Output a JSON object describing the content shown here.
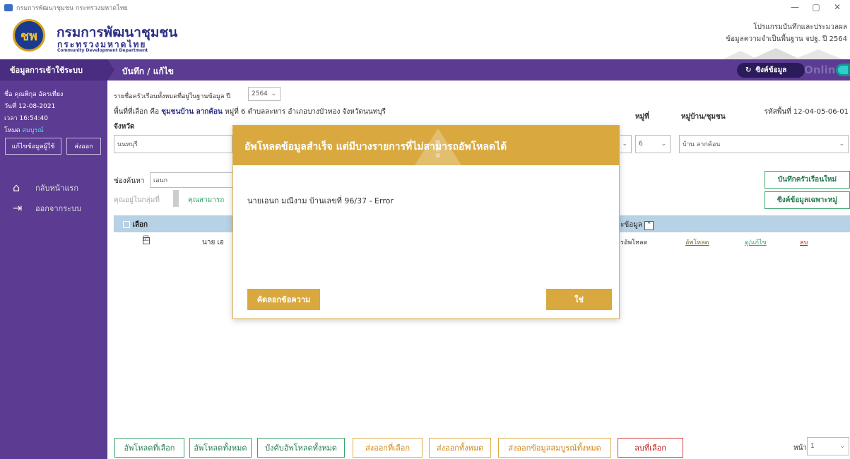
{
  "window": {
    "title": "กรมการพัฒนาชุมชน กระทรวงมหาดไทย",
    "controls": [
      "—",
      "▢",
      "✕"
    ]
  },
  "header": {
    "logo_text": "ชพ",
    "org_thai": "กรมการพัฒนาชุมชน",
    "org_ministry": "กระทรวงมหาดไทย",
    "org_english": "Community Development Department",
    "program_name": "โปรแกรมบันทึกและประมวลผล",
    "program_sub": "ข้อมูลความจำเป็นพื้นฐาน จปฐ. ปี 2564"
  },
  "navbar": {
    "left_label": "ข้อมูลการเข้าใช้ระบบ",
    "page_title": "บันทึก / แก้ไข",
    "sync_label": "ซิงค์ข้อมูล",
    "status": "Online"
  },
  "sidebar": {
    "name_line": "ชื่อ คุณพิกุล อัครเที่ยง",
    "date_line": "วันที่ 12-08-2021",
    "time_line": "เวลา 16:54:40",
    "mode_label": "โหมด",
    "mode_value": "สมบูรณ์",
    "edit_user_button": "แก้ไขข้อมูลผู้ใช้",
    "export_button": "ส่งออก",
    "menu": [
      {
        "label": "กลับหน้าแรก",
        "icon": "home-icon"
      },
      {
        "label": "ออกจากระบบ",
        "icon": "logout-icon"
      }
    ]
  },
  "main": {
    "list_label": "รายชื่อครัวเรือนทั้งหมดที่อยู่ในฐานข้อมูล ปี",
    "year": "2564",
    "area_prefix": "พื้นที่ที่เลือก คือ",
    "area_value": "ชุมชนบ้าน ลากค้อน",
    "area_rest": "หมู่ที่ 6 ตำบลละหาร อำเภอบางบัวทอง จังหวัดนนทบุรี",
    "area_code": "รหัสพื้นที่ 12-04-05-06-01",
    "province_label": "จังหวัด",
    "province_value": "นนทบุรี",
    "moo_label": "หมู่ที่",
    "moo_value": "6",
    "village_label": "หมู่บ้าน/ชุมชน",
    "village_value": "บ้าน ลากค้อน",
    "search_label": "ช่องค้นหา",
    "search_value": "เอนก",
    "tab_in_group": "คุณอยู่ในกลุ่มที่",
    "tab_can": "คุณสามารถ",
    "new_household_button": "บันทึกครัวเรือนใหม่",
    "sync_moo_button": "ซิงค์ข้อมูลเฉพาะหมู่",
    "table": {
      "select_header": "เลือก",
      "status_header": "ะข้อมูล",
      "row": {
        "name": "นาย เอ",
        "status": "รอัพโหลด",
        "upload_link": "อัพโหลด",
        "edit_link": "ดู/แก้ไข",
        "delete_link": "ลบ"
      }
    },
    "bottom_buttons": [
      "อัพโหลดที่เลือก",
      "อัพโหลดทั้งหมด",
      "บังคับอัพโหลดทั้งหมด",
      "ส่งออกที่เลือก",
      "ส่งออกทั้งหมด",
      "ส่งออกข้อมูลสมบูรณ์ทั้งหมด",
      "ลบที่เลือก"
    ],
    "page_label": "หน้า",
    "page_value": "1"
  },
  "dialog": {
    "title": "อัพโหลดข้อมูลสำเร็จ แต่มีบางรายการที่ไม่สามารถอัพโหลดได้",
    "message": "นายเอนก มณีงาม บ้านเลขที่ 96/37 - Error",
    "copy_button": "คัดลอกข้อความ",
    "ok_button": "ใช่"
  },
  "colors": {
    "purple": "#5c3b92",
    "gold": "#d9a93f",
    "green": "#3aa56a",
    "table_head": "#b7d1e5"
  }
}
